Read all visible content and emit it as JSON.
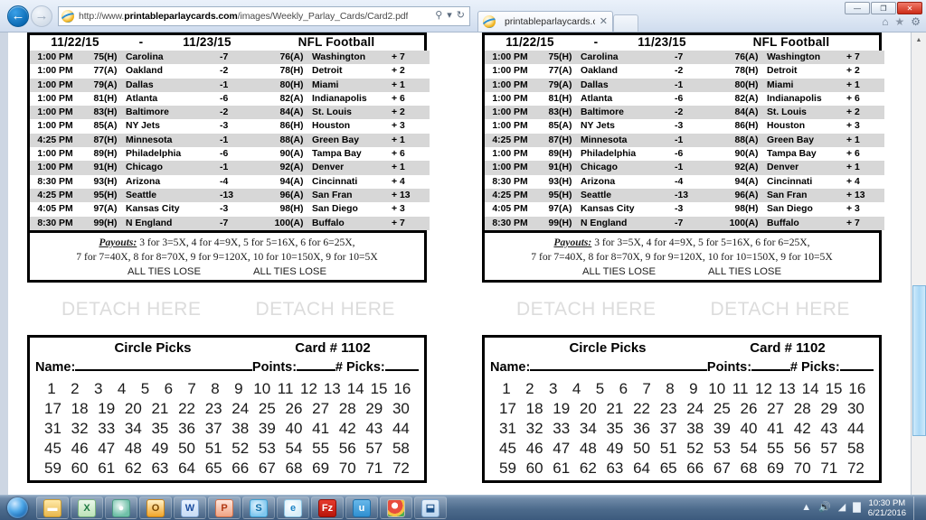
{
  "browser": {
    "back_label": "←",
    "forward_label": "→",
    "url_scheme": "http://www.",
    "url_host": "printableparlaycards.com",
    "url_path": "/images/Weekly_Parlay_Cards/Card2.pdf",
    "search_icon": "⚲",
    "caret_icon": "▾",
    "refresh_icon": "↻",
    "tab_title": "printableparlaycards.com",
    "tab_close": "✕",
    "minimize_label": "—",
    "maximize_label": "❐",
    "close_label": "✕",
    "home_icon": "⌂",
    "favorites_icon": "★",
    "settings_icon": "⚙"
  },
  "card": {
    "date_start": "11/22/15",
    "dash": "-",
    "date_end": "11/23/15",
    "sport_title": "NFL Football",
    "games": [
      {
        "time": "1:00 PM",
        "num_a": "75",
        "ha_a": "(H)",
        "team_a": "Carolina",
        "line_a": "-7",
        "num_b": "76",
        "ha_b": "(A)",
        "team_b": "Washington",
        "line_b": "+ 7"
      },
      {
        "time": "1:00 PM",
        "num_a": "77",
        "ha_a": "(A)",
        "team_a": "Oakland",
        "line_a": "-2",
        "num_b": "78",
        "ha_b": "(H)",
        "team_b": "Detroit",
        "line_b": "+ 2"
      },
      {
        "time": "1:00 PM",
        "num_a": "79",
        "ha_a": "(A)",
        "team_a": "Dallas",
        "line_a": "-1",
        "num_b": "80",
        "ha_b": "(H)",
        "team_b": "Miami",
        "line_b": "+ 1"
      },
      {
        "time": "1:00 PM",
        "num_a": "81",
        "ha_a": "(H)",
        "team_a": "Atlanta",
        "line_a": "-6",
        "num_b": "82",
        "ha_b": "(A)",
        "team_b": "Indianapolis",
        "line_b": "+ 6"
      },
      {
        "time": "1:00 PM",
        "num_a": "83",
        "ha_a": "(H)",
        "team_a": "Baltimore",
        "line_a": "-2",
        "num_b": "84",
        "ha_b": "(A)",
        "team_b": "St. Louis",
        "line_b": "+ 2"
      },
      {
        "time": "1:00 PM",
        "num_a": "85",
        "ha_a": "(A)",
        "team_a": "NY Jets",
        "line_a": "-3",
        "num_b": "86",
        "ha_b": "(H)",
        "team_b": "Houston",
        "line_b": "+ 3"
      },
      {
        "time": "4:25 PM",
        "num_a": "87",
        "ha_a": "(H)",
        "team_a": "Minnesota",
        "line_a": "-1",
        "num_b": "88",
        "ha_b": "(A)",
        "team_b": "Green Bay",
        "line_b": "+ 1"
      },
      {
        "time": "1:00 PM",
        "num_a": "89",
        "ha_a": "(H)",
        "team_a": "Philadelphia",
        "line_a": "-6",
        "num_b": "90",
        "ha_b": "(A)",
        "team_b": "Tampa Bay",
        "line_b": "+ 6"
      },
      {
        "time": "1:00 PM",
        "num_a": "91",
        "ha_a": "(H)",
        "team_a": "Chicago",
        "line_a": "-1",
        "num_b": "92",
        "ha_b": "(A)",
        "team_b": "Denver",
        "line_b": "+ 1"
      },
      {
        "time": "8:30 PM",
        "num_a": "93",
        "ha_a": "(H)",
        "team_a": "Arizona",
        "line_a": "-4",
        "num_b": "94",
        "ha_b": "(A)",
        "team_b": "Cincinnati",
        "line_b": "+ 4"
      },
      {
        "time": "4:25 PM",
        "num_a": "95",
        "ha_a": "(H)",
        "team_a": "Seattle",
        "line_a": "-13",
        "num_b": "96",
        "ha_b": "(A)",
        "team_b": "San Fran",
        "line_b": "+ 13"
      },
      {
        "time": "4:05 PM",
        "num_a": "97",
        "ha_a": "(A)",
        "team_a": "Kansas City",
        "line_a": "-3",
        "num_b": "98",
        "ha_b": "(H)",
        "team_b": "San Diego",
        "line_b": "+ 3"
      },
      {
        "time": "8:30 PM",
        "num_a": "99",
        "ha_a": "(H)",
        "team_a": "N England",
        "line_a": "-7",
        "num_b": "100",
        "ha_b": "(A)",
        "team_b": "Buffalo",
        "line_b": "+ 7"
      }
    ],
    "payouts_label": "Payouts:",
    "payouts_line1": "3 for 3=5X, 4 for 4=9X, 5 for 5=16X, 6 for 6=25X,",
    "payouts_line2": "7 for 7=40X, 8 for 8=70X, 9 for 9=120X, 10 for 10=150X, 9 for 10=5X",
    "ties_left": "ALL TIES LOSE",
    "ties_right": "ALL TIES LOSE"
  },
  "detach": {
    "left": "DETACH HERE",
    "right": "DETACH HERE"
  },
  "picks": {
    "title": "Circle Picks",
    "card_number": "Card # 1102",
    "name_label": "Name:",
    "points_label": "Points:",
    "numpicks_label": "# Picks:",
    "rows": [
      [
        "1",
        "2",
        "3",
        "4",
        "5",
        "6",
        "7",
        "8",
        "9",
        "10",
        "11",
        "12",
        "13",
        "14",
        "15",
        "16"
      ],
      [
        "17",
        "18",
        "19",
        "20",
        "21",
        "22",
        "23",
        "24",
        "25",
        "26",
        "27",
        "28",
        "29",
        "30"
      ],
      [
        "31",
        "32",
        "33",
        "34",
        "35",
        "36",
        "37",
        "38",
        "39",
        "40",
        "41",
        "42",
        "43",
        "44"
      ],
      [
        "45",
        "46",
        "47",
        "48",
        "49",
        "50",
        "51",
        "52",
        "53",
        "54",
        "55",
        "56",
        "57",
        "58"
      ],
      [
        "59",
        "60",
        "61",
        "62",
        "63",
        "64",
        "65",
        "66",
        "67",
        "68",
        "69",
        "70",
        "71",
        "72"
      ]
    ]
  },
  "scrollbar": {
    "up_arrow": "▲",
    "down_arrow": "▼"
  },
  "taskbar": {
    "start_label": "Start",
    "items": [
      {
        "name": "windows-explorer",
        "class": "ico-explorer",
        "glyph": "▬"
      },
      {
        "name": "excel",
        "class": "ico-excel",
        "glyph": "X"
      },
      {
        "name": "recycle-app",
        "class": "ico-teal",
        "glyph": "●"
      },
      {
        "name": "outlook",
        "class": "ico-outlook",
        "glyph": "O"
      },
      {
        "name": "word",
        "class": "ico-word",
        "glyph": "W"
      },
      {
        "name": "powerpoint",
        "class": "ico-ppt",
        "glyph": "P"
      },
      {
        "name": "skype",
        "class": "ico-skype",
        "glyph": "S"
      },
      {
        "name": "internet-explorer",
        "class": "ico-ie",
        "glyph": "e"
      },
      {
        "name": "filezilla",
        "class": "ico-fz",
        "glyph": "Fz"
      },
      {
        "name": "u-app",
        "class": "ico-u",
        "glyph": "u"
      },
      {
        "name": "chrome",
        "class": "ico-chrome",
        "glyph": ""
      },
      {
        "name": "save-app",
        "class": "ico-blue",
        "glyph": "⬓"
      }
    ],
    "tray": {
      "overflow_icon": "▲",
      "volume_icon": "🔊",
      "network_icon": "◢",
      "battery_icon": "▇",
      "time": "10:30 PM",
      "date": "6/21/2016"
    }
  }
}
